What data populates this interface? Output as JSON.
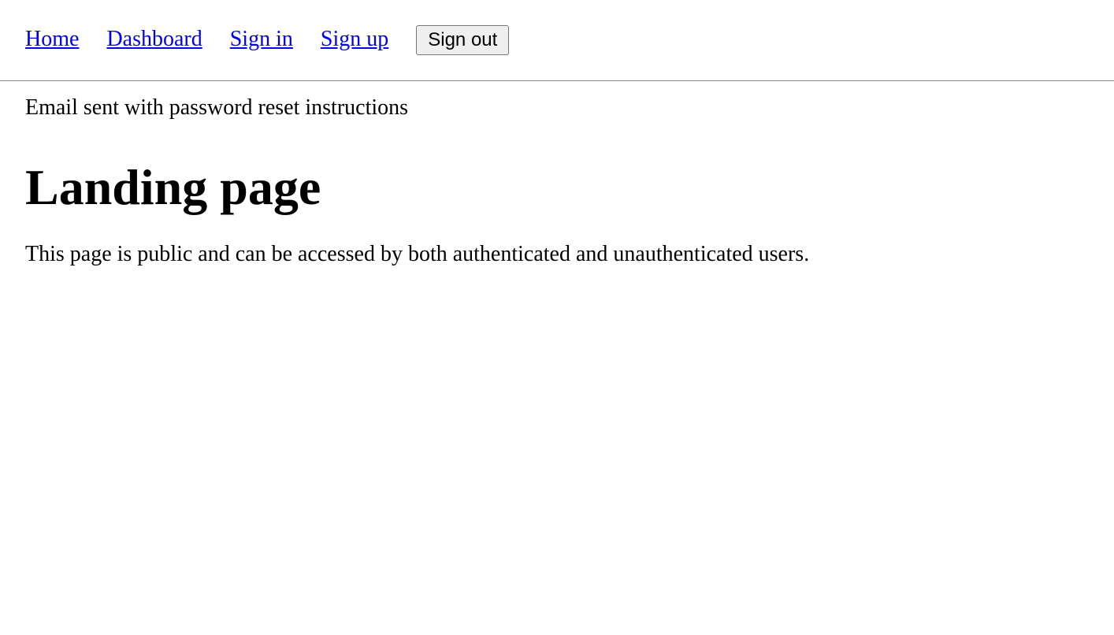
{
  "nav": {
    "home": "Home",
    "dashboard": "Dashboard",
    "sign_in": "Sign in",
    "sign_up": "Sign up",
    "sign_out": "Sign out"
  },
  "flash": {
    "message": "Email sent with password reset instructions"
  },
  "main": {
    "heading": "Landing page",
    "description": "This page is public and can be accessed by both authenticated and unauthenticated users."
  }
}
